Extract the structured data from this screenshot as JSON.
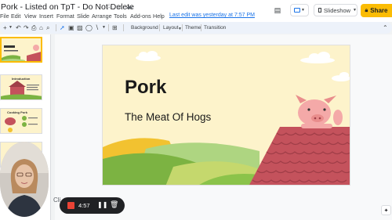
{
  "header": {
    "doc_title": "Pork - Listed on TpT - Do Not Delete",
    "last_edit": "Last edit was yesterday at 7:57 PM",
    "slideshow_label": "Slideshow",
    "share_label": "Share",
    "menu": [
      "File",
      "Edit",
      "View",
      "Insert",
      "Format",
      "Slide",
      "Arrange",
      "Tools",
      "Add-ons",
      "Help"
    ]
  },
  "toolbar": {
    "background_label": "Background",
    "layout_label": "Layout",
    "theme_label": "Theme",
    "transition_label": "Transition"
  },
  "filmstrip": {
    "slides": [
      {
        "number": "1",
        "label": ""
      },
      {
        "number": "2",
        "label": "Introduction"
      },
      {
        "number": "3",
        "label": "Cooking Pork"
      }
    ]
  },
  "slide": {
    "title": "Pork",
    "subtitle": "The Meat Of Hogs"
  },
  "notes": {
    "placeholder": "Cli"
  },
  "recorder": {
    "time": "4:57"
  },
  "colors": {
    "slide_background": "#fdf3cb",
    "share_button": "#fbbc04",
    "roof": "#c4525c",
    "hill_dark": "#7cb342",
    "hill_light": "#c5d86d",
    "hill_yellow": "#f2c230",
    "pig": "#f4a9a8",
    "record_stop": "#ea4335"
  }
}
